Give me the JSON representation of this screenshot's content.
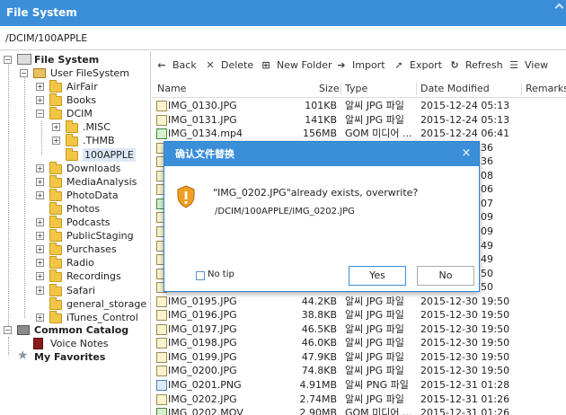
{
  "window": {
    "title": "File System"
  },
  "pathbar": {
    "path": "/DCIM/100APPLE"
  },
  "tree": {
    "root": "File System",
    "user_fs": "User FileSystem",
    "folders": [
      "AirFair",
      "Books",
      "DCIM",
      ".MISC",
      ".THMB",
      "100APPLE",
      "Downloads",
      "MediaAnalysis",
      "PhotoData",
      "Photos",
      "Podcasts",
      "PublicStaging",
      "Purchases",
      "Radio",
      "Recordings",
      "Safari",
      "general_storage",
      "iTunes_Control"
    ],
    "common_catalog": "Common Catalog",
    "voice_notes": "Voice Notes",
    "my_favorites": "My Favorites"
  },
  "toolbar": {
    "back": "Back",
    "delete": "Delete",
    "new_folder": "New Folder",
    "import": "Import",
    "export": "Export",
    "refresh": "Refresh",
    "view": "View"
  },
  "columns": {
    "name": "Name",
    "size": "Size",
    "type": "Type",
    "date": "Date Modified",
    "remarks": "Remarks"
  },
  "files": [
    {
      "name": "IMG_0130.JPG",
      "size": "101KB",
      "type": "알씨 JPG 파일",
      "date": "2015-12-24 05:13",
      "kind": "jpg"
    },
    {
      "name": "IMG_0131.JPG",
      "size": "141KB",
      "type": "알씨 JPG 파일",
      "date": "2015-12-24 05:13",
      "kind": "jpg"
    },
    {
      "name": "IMG_0134.mp4",
      "size": "156MB",
      "type": "GOM 미디어 ...",
      "date": "2015-12-24 06:41",
      "kind": "mov"
    },
    {
      "name": "",
      "size": "",
      "type": "",
      "date": "36",
      "kind": "jpg"
    },
    {
      "name": "",
      "size": "",
      "type": "",
      "date": "36",
      "kind": "jpg"
    },
    {
      "name": "",
      "size": "",
      "type": "",
      "date": "08",
      "kind": "jpg"
    },
    {
      "name": "",
      "size": "",
      "type": "",
      "date": "06",
      "kind": "jpg"
    },
    {
      "name": "",
      "size": "",
      "type": "",
      "date": "07",
      "kind": "mov"
    },
    {
      "name": "",
      "size": "",
      "type": "",
      "date": "09",
      "kind": "jpg"
    },
    {
      "name": "",
      "size": "",
      "type": "",
      "date": "09",
      "kind": "jpg"
    },
    {
      "name": "",
      "size": "",
      "type": "",
      "date": "49",
      "kind": "jpg"
    },
    {
      "name": "",
      "size": "",
      "type": "",
      "date": "49",
      "kind": "jpg"
    },
    {
      "name": "",
      "size": "",
      "type": "",
      "date": "50",
      "kind": "jpg"
    },
    {
      "name": "",
      "size": "",
      "type": "",
      "date": "50",
      "kind": "jpg"
    },
    {
      "name": "IMG_0195.JPG",
      "size": "44.2KB",
      "type": "알씨 JPG 파일",
      "date": "2015-12-30 19:50",
      "kind": "jpg"
    },
    {
      "name": "IMG_0196.JPG",
      "size": "38.8KB",
      "type": "알씨 JPG 파일",
      "date": "2015-12-30 19:50",
      "kind": "jpg"
    },
    {
      "name": "IMG_0197.JPG",
      "size": "46.5KB",
      "type": "알씨 JPG 파일",
      "date": "2015-12-30 19:50",
      "kind": "jpg"
    },
    {
      "name": "IMG_0198.JPG",
      "size": "46.0KB",
      "type": "알씨 JPG 파일",
      "date": "2015-12-30 19:50",
      "kind": "jpg"
    },
    {
      "name": "IMG_0199.JPG",
      "size": "47.9KB",
      "type": "알씨 JPG 파일",
      "date": "2015-12-30 19:50",
      "kind": "jpg"
    },
    {
      "name": "IMG_0200.JPG",
      "size": "74.8KB",
      "type": "알씨 JPG 파일",
      "date": "2015-12-30 19:50",
      "kind": "jpg"
    },
    {
      "name": "IMG_0201.PNG",
      "size": "4.91MB",
      "type": "알씨 PNG 파일",
      "date": "2015-12-31 01:28",
      "kind": "png"
    },
    {
      "name": "IMG_0202.JPG",
      "size": "2.74MB",
      "type": "알씨 JPG 파일",
      "date": "2015-12-31 01:26",
      "kind": "jpg"
    },
    {
      "name": "IMG_0202.MOV",
      "size": "2.90MB",
      "type": "GOM 미디어 ...",
      "date": "2015-12-31 01:26",
      "kind": "mov"
    }
  ],
  "dialog": {
    "title": "确认文件替换",
    "message": "\"IMG_0202.JPG\"already exists, overwrite?",
    "path": "/DCIM/100APPLE/IMG_0202.JPG",
    "no_tip": "No tip",
    "yes": "Yes",
    "no": "No",
    "close": "×"
  }
}
